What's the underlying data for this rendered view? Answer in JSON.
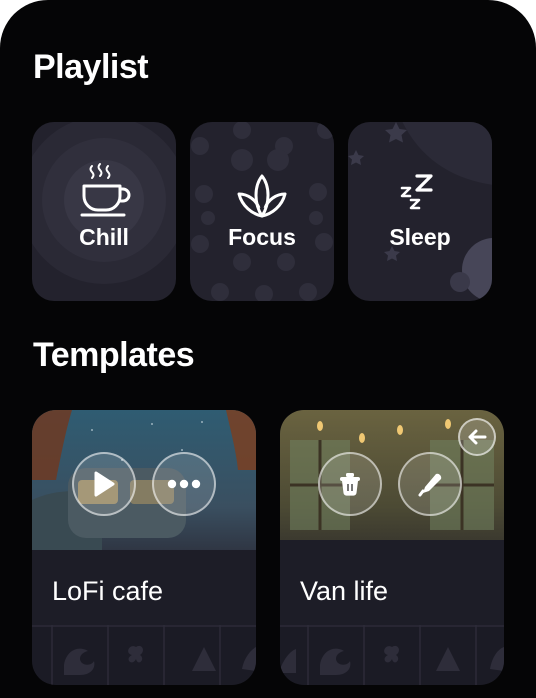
{
  "playlist": {
    "title": "Playlist",
    "items": [
      {
        "label": "Chill",
        "icon": "coffee-cup-icon"
      },
      {
        "label": "Focus",
        "icon": "lotus-icon"
      },
      {
        "label": "Sleep",
        "icon": "zzz-icon"
      }
    ]
  },
  "templates": {
    "title": "Templates",
    "items": [
      {
        "title": "LoFi cafe",
        "actions": [
          "play-icon",
          "more-icon"
        ]
      },
      {
        "title": "Van life",
        "actions": [
          "delete-icon",
          "edit-icon",
          "back-arrow-icon"
        ]
      }
    ]
  },
  "colors": {
    "panel": "#050506",
    "card": "#23222d",
    "text": "#ffffff"
  }
}
